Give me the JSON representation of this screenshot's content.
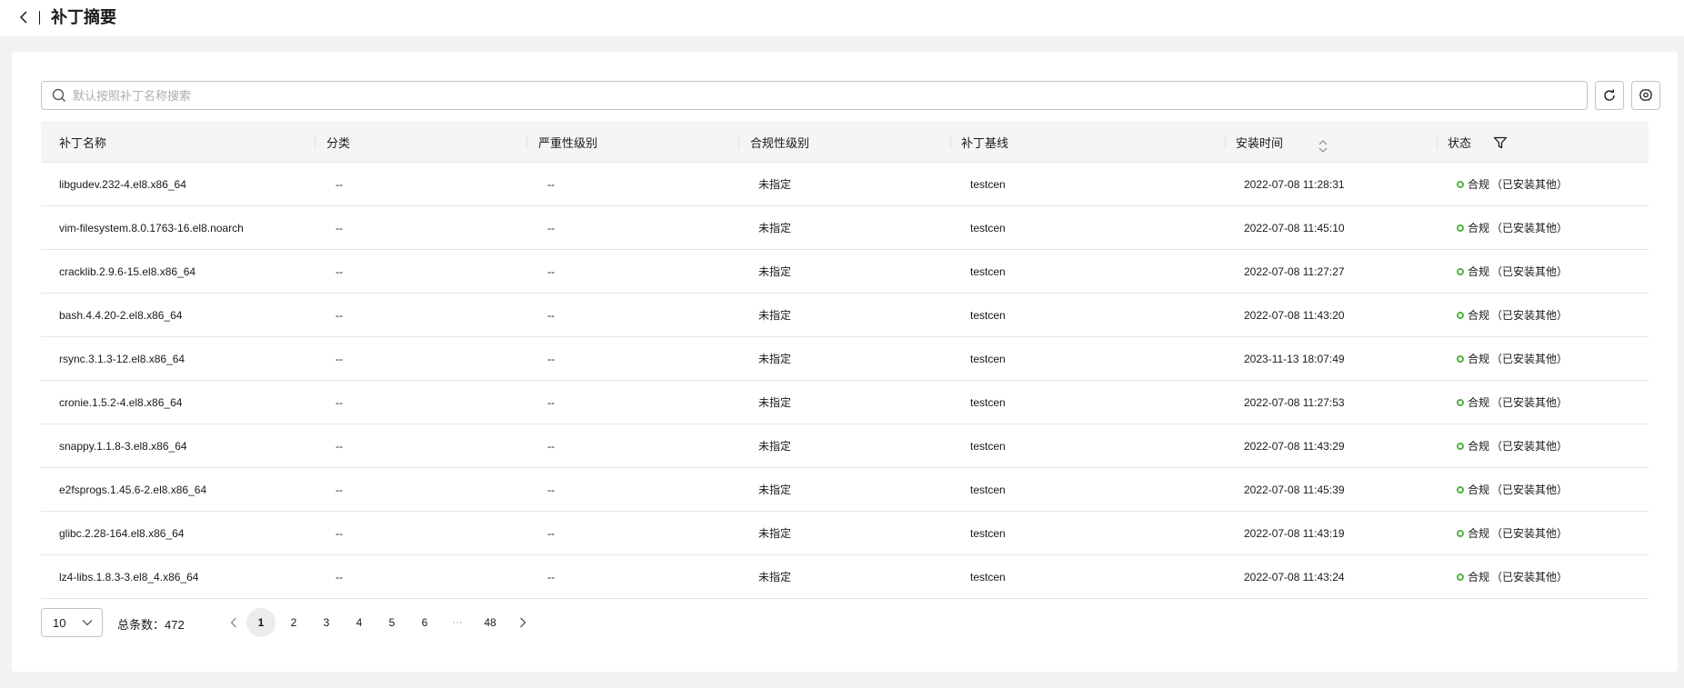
{
  "header": {
    "title": "补丁摘要"
  },
  "search": {
    "placeholder": "默认按照补丁名称搜索"
  },
  "table": {
    "columns": [
      "补丁名称",
      "分类",
      "严重性级别",
      "合规性级别",
      "补丁基线",
      "安装时间",
      "状态"
    ],
    "rows": [
      {
        "name": "libgudev.232-4.el8.x86_64",
        "category": "--",
        "severity": "--",
        "compliance": "未指定",
        "baseline": "testcen",
        "install_time": "2022-07-08 11:28:31",
        "status": "合规",
        "status_detail": "（已安装其他）"
      },
      {
        "name": "vim-filesystem.8.0.1763-16.el8.noarch",
        "category": "--",
        "severity": "--",
        "compliance": "未指定",
        "baseline": "testcen",
        "install_time": "2022-07-08 11:45:10",
        "status": "合规",
        "status_detail": "（已安装其他）"
      },
      {
        "name": "cracklib.2.9.6-15.el8.x86_64",
        "category": "--",
        "severity": "--",
        "compliance": "未指定",
        "baseline": "testcen",
        "install_time": "2022-07-08 11:27:27",
        "status": "合规",
        "status_detail": "（已安装其他）"
      },
      {
        "name": "bash.4.4.20-2.el8.x86_64",
        "category": "--",
        "severity": "--",
        "compliance": "未指定",
        "baseline": "testcen",
        "install_time": "2022-07-08 11:43:20",
        "status": "合规",
        "status_detail": "（已安装其他）"
      },
      {
        "name": "rsync.3.1.3-12.el8.x86_64",
        "category": "--",
        "severity": "--",
        "compliance": "未指定",
        "baseline": "testcen",
        "install_time": "2023-11-13 18:07:49",
        "status": "合规",
        "status_detail": "（已安装其他）"
      },
      {
        "name": "cronie.1.5.2-4.el8.x86_64",
        "category": "--",
        "severity": "--",
        "compliance": "未指定",
        "baseline": "testcen",
        "install_time": "2022-07-08 11:27:53",
        "status": "合规",
        "status_detail": "（已安装其他）"
      },
      {
        "name": "snappy.1.1.8-3.el8.x86_64",
        "category": "--",
        "severity": "--",
        "compliance": "未指定",
        "baseline": "testcen",
        "install_time": "2022-07-08 11:43:29",
        "status": "合规",
        "status_detail": "（已安装其他）"
      },
      {
        "name": "e2fsprogs.1.45.6-2.el8.x86_64",
        "category": "--",
        "severity": "--",
        "compliance": "未指定",
        "baseline": "testcen",
        "install_time": "2022-07-08 11:45:39",
        "status": "合规",
        "status_detail": "（已安装其他）"
      },
      {
        "name": "glibc.2.28-164.el8.x86_64",
        "category": "--",
        "severity": "--",
        "compliance": "未指定",
        "baseline": "testcen",
        "install_time": "2022-07-08 11:43:19",
        "status": "合规",
        "status_detail": "（已安装其他）"
      },
      {
        "name": "lz4-libs.1.8.3-3.el8_4.x86_64",
        "category": "--",
        "severity": "--",
        "compliance": "未指定",
        "baseline": "testcen",
        "install_time": "2022-07-08 11:43:24",
        "status": "合规",
        "status_detail": "（已安装其他）"
      }
    ]
  },
  "pagination": {
    "page_size": "10",
    "total_label": "总条数：472",
    "pages": [
      "1",
      "2",
      "3",
      "4",
      "5",
      "6"
    ],
    "ellipsis": "···",
    "last_page": "48",
    "current_page": 1
  },
  "colors": {
    "status_ok": "#50b340",
    "page_bg": "#f1f2f3",
    "header_bg": "#f5f5f5"
  },
  "icons": {
    "back": "chevron-left-icon",
    "search": "search-icon",
    "refresh": "refresh-icon",
    "settings": "gear-icon",
    "sort": "sort-icon",
    "filter": "filter-icon"
  }
}
